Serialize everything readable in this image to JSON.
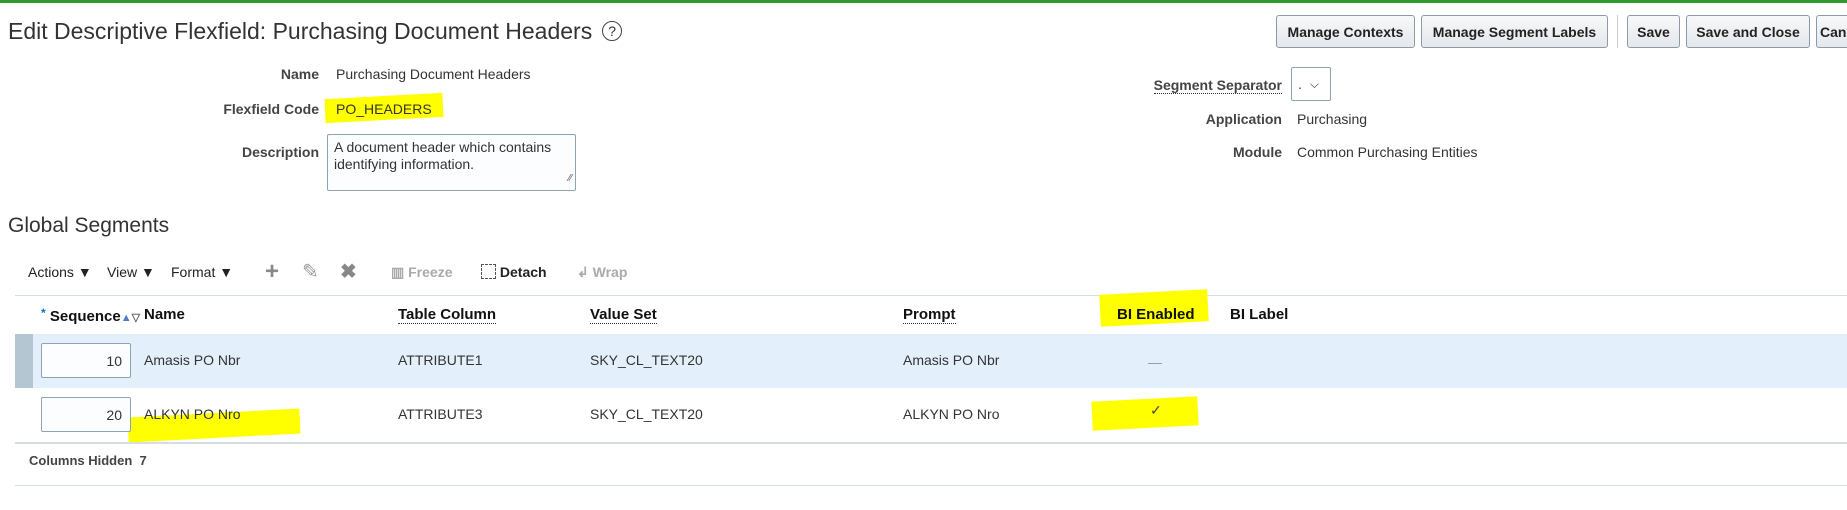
{
  "header": {
    "title": "Edit Descriptive Flexfield: Purchasing Document Headers",
    "help_icon": "?"
  },
  "buttons": {
    "manage_contexts": "Manage Contexts",
    "manage_segment_labels": "Manage Segment Labels",
    "save": "Save",
    "save_and_close": "Save and Close",
    "cancel": "Can"
  },
  "form": {
    "name_label": "Name",
    "name_value": "Purchasing Document Headers",
    "code_label": "Flexfield Code",
    "code_value": "PO_HEADERS",
    "description_label": "Description",
    "description_value": "A document header which contains identifying information.",
    "separator_label": "Segment Separator",
    "separator_value": ".",
    "application_label": "Application",
    "application_value": "Purchasing",
    "module_label": "Module",
    "module_value": "Common Purchasing Entities"
  },
  "section": {
    "title": "Global Segments"
  },
  "toolbar": {
    "actions": "Actions",
    "view": "View",
    "format": "Format",
    "freeze": "Freeze",
    "detach": "Detach",
    "wrap": "Wrap"
  },
  "table": {
    "headers": {
      "sequence": "Sequence",
      "name": "Name",
      "table_column": "Table Column",
      "value_set": "Value Set",
      "prompt": "Prompt",
      "bi_enabled": "BI Enabled",
      "bi_label": "BI Label"
    },
    "rows": [
      {
        "sequence": "10",
        "name": "Amasis PO Nbr",
        "table_column": "ATTRIBUTE1",
        "value_set": "SKY_CL_TEXT20",
        "prompt": "Amasis PO Nbr",
        "bi_enabled": "—",
        "bi_label": ""
      },
      {
        "sequence": "20",
        "name": "ALKYN PO Nro",
        "table_column": "ATTRIBUTE3",
        "value_set": "SKY_CL_TEXT20",
        "prompt": "ALKYN PO Nro",
        "bi_enabled": "✓",
        "bi_label": ""
      }
    ]
  },
  "footer": {
    "columns_hidden_label": "Columns Hidden",
    "columns_hidden_count": "7"
  },
  "colors": {
    "accent_bar": "#2e9b2e",
    "selected_row": "#e3f0fc",
    "highlight": "#ffff00"
  }
}
